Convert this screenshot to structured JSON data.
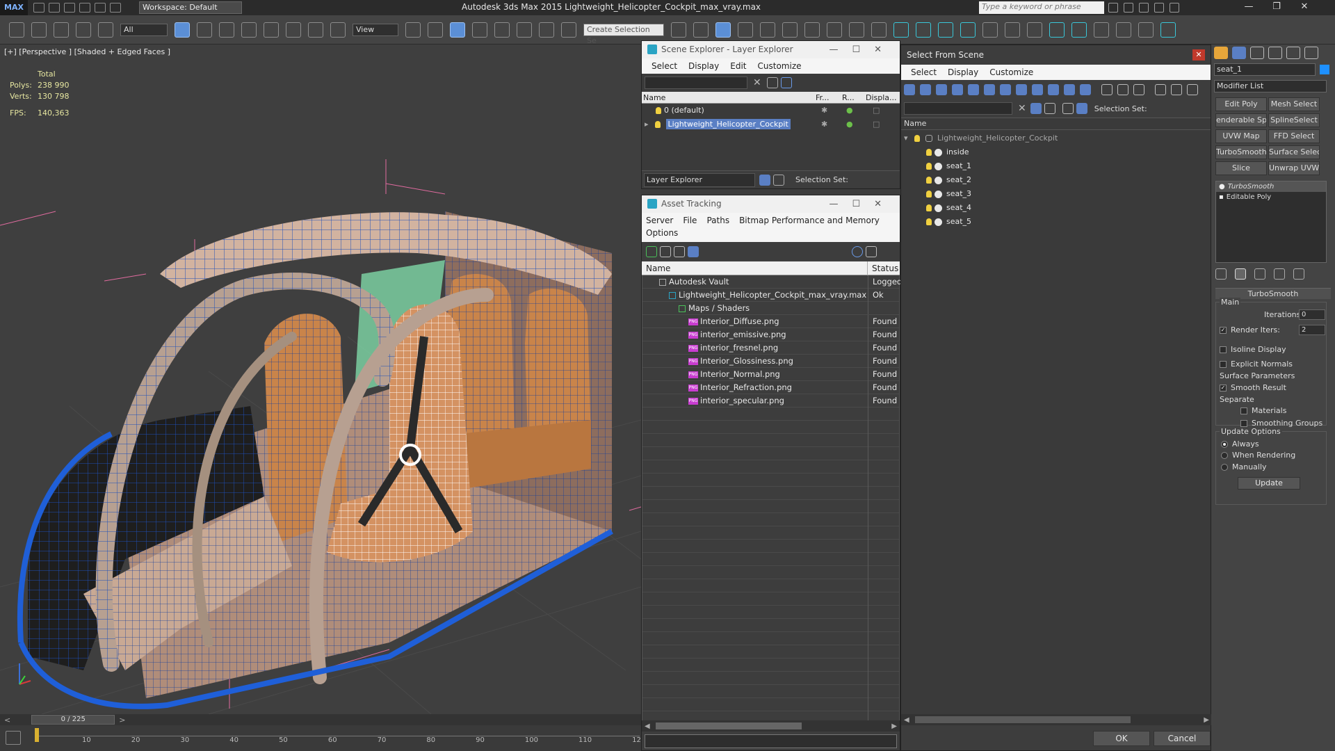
{
  "app": {
    "logo": "MAX",
    "workspace": "Workspace: Default",
    "title": "Autodesk 3ds Max  2015     Lightweight_Helicopter_Cockpit_max_vray.max",
    "search_placeholder": "Type a keyword or phrase"
  },
  "toolbar": {
    "filter": "All",
    "ref_coord": "View",
    "selection_set": "Create Selection Se"
  },
  "viewport": {
    "label": "[+] [Perspective ] [Shaded + Edged Faces ]",
    "stats": {
      "total_label": "Total",
      "polys_label": "Polys:",
      "polys": "238 990",
      "verts_label": "Verts:",
      "verts": "130 798",
      "fps_label": "FPS:",
      "fps": "140,363"
    }
  },
  "timeline": {
    "frame": "0 / 225",
    "ticks": [
      "10",
      "20",
      "30",
      "40",
      "50",
      "60",
      "70",
      "80",
      "90",
      "100",
      "110",
      "12"
    ]
  },
  "scene_explorer": {
    "title": "Scene Explorer - Layer Explorer",
    "menu": [
      "Select",
      "Display",
      "Edit",
      "Customize"
    ],
    "cols": {
      "name": "Name",
      "frozen": "Fr...",
      "render": "R...",
      "display": "Displa..."
    },
    "layers": [
      {
        "name": "0 (default)"
      },
      {
        "name": "Lightweight_Helicopter_Cockpit"
      }
    ],
    "footer_dropdown": "Layer Explorer",
    "selection_set_label": "Selection Set:"
  },
  "asset_tracking": {
    "title": "Asset Tracking",
    "menu": [
      "Server",
      "File",
      "Paths",
      "Bitmap Performance and Memory"
    ],
    "menu2": "Options",
    "cols": {
      "name": "Name",
      "status": "Status"
    },
    "rows": [
      {
        "name": "Autodesk Vault",
        "status": "Logged",
        "indent": 1
      },
      {
        "name": "Lightweight_Helicopter_Cockpit_max_vray.max",
        "status": "Ok",
        "indent": 2
      },
      {
        "name": "Maps / Shaders",
        "status": "",
        "indent": 3
      },
      {
        "name": "Interior_Diffuse.png",
        "status": "Found",
        "indent": 4
      },
      {
        "name": "interior_emissive.png",
        "status": "Found",
        "indent": 4
      },
      {
        "name": "interior_fresnel.png",
        "status": "Found",
        "indent": 4
      },
      {
        "name": "Interior_Glossiness.png",
        "status": "Found",
        "indent": 4
      },
      {
        "name": "Interior_Normal.png",
        "status": "Found",
        "indent": 4
      },
      {
        "name": "Interior_Refraction.png",
        "status": "Found",
        "indent": 4
      },
      {
        "name": "interior_specular.png",
        "status": "Found",
        "indent": 4
      }
    ]
  },
  "select_from_scene": {
    "title": "Select From Scene",
    "menu": [
      "Select",
      "Display",
      "Customize"
    ],
    "selection_set_label": "Selection Set:",
    "col_name": "Name",
    "root": "Lightweight_Helicopter_Cockpit",
    "children": [
      "inside",
      "seat_1",
      "seat_2",
      "seat_3",
      "seat_4",
      "seat_5"
    ],
    "ok": "OK",
    "cancel": "Cancel"
  },
  "command_panel": {
    "object_name": "seat_1",
    "modifier_list": "Modifier List",
    "mod_buttons": [
      "Edit Poly",
      "Mesh Select",
      "enderable Splir",
      "SplineSelect",
      "UVW Map",
      "FFD Select",
      "TurboSmooth",
      "Surface Select",
      "Slice",
      "Unwrap UVW"
    ],
    "stack": [
      "TurboSmooth",
      "Editable Poly"
    ],
    "rollout": {
      "title": "TurboSmooth",
      "main": "Main",
      "iterations_label": "Iterations:",
      "iterations": "0",
      "render_iters_label": "Render Iters:",
      "render_iters": "2",
      "isoline": "Isoline Display",
      "explicit_normals": "Explicit Normals",
      "surface_params": "Surface Parameters",
      "smooth_result": "Smooth Result",
      "separate": "Separate",
      "materials": "Materials",
      "smoothing_groups": "Smoothing Groups",
      "update_options": "Update Options",
      "always": "Always",
      "when_rendering": "When Rendering",
      "manually": "Manually",
      "update": "Update"
    }
  },
  "colors": {
    "accent": "#5a7fc4",
    "wire": "#1f5fd8",
    "seat": "#c9844a",
    "floor": "#b08d7a",
    "selected_wire": "#ffffff"
  }
}
